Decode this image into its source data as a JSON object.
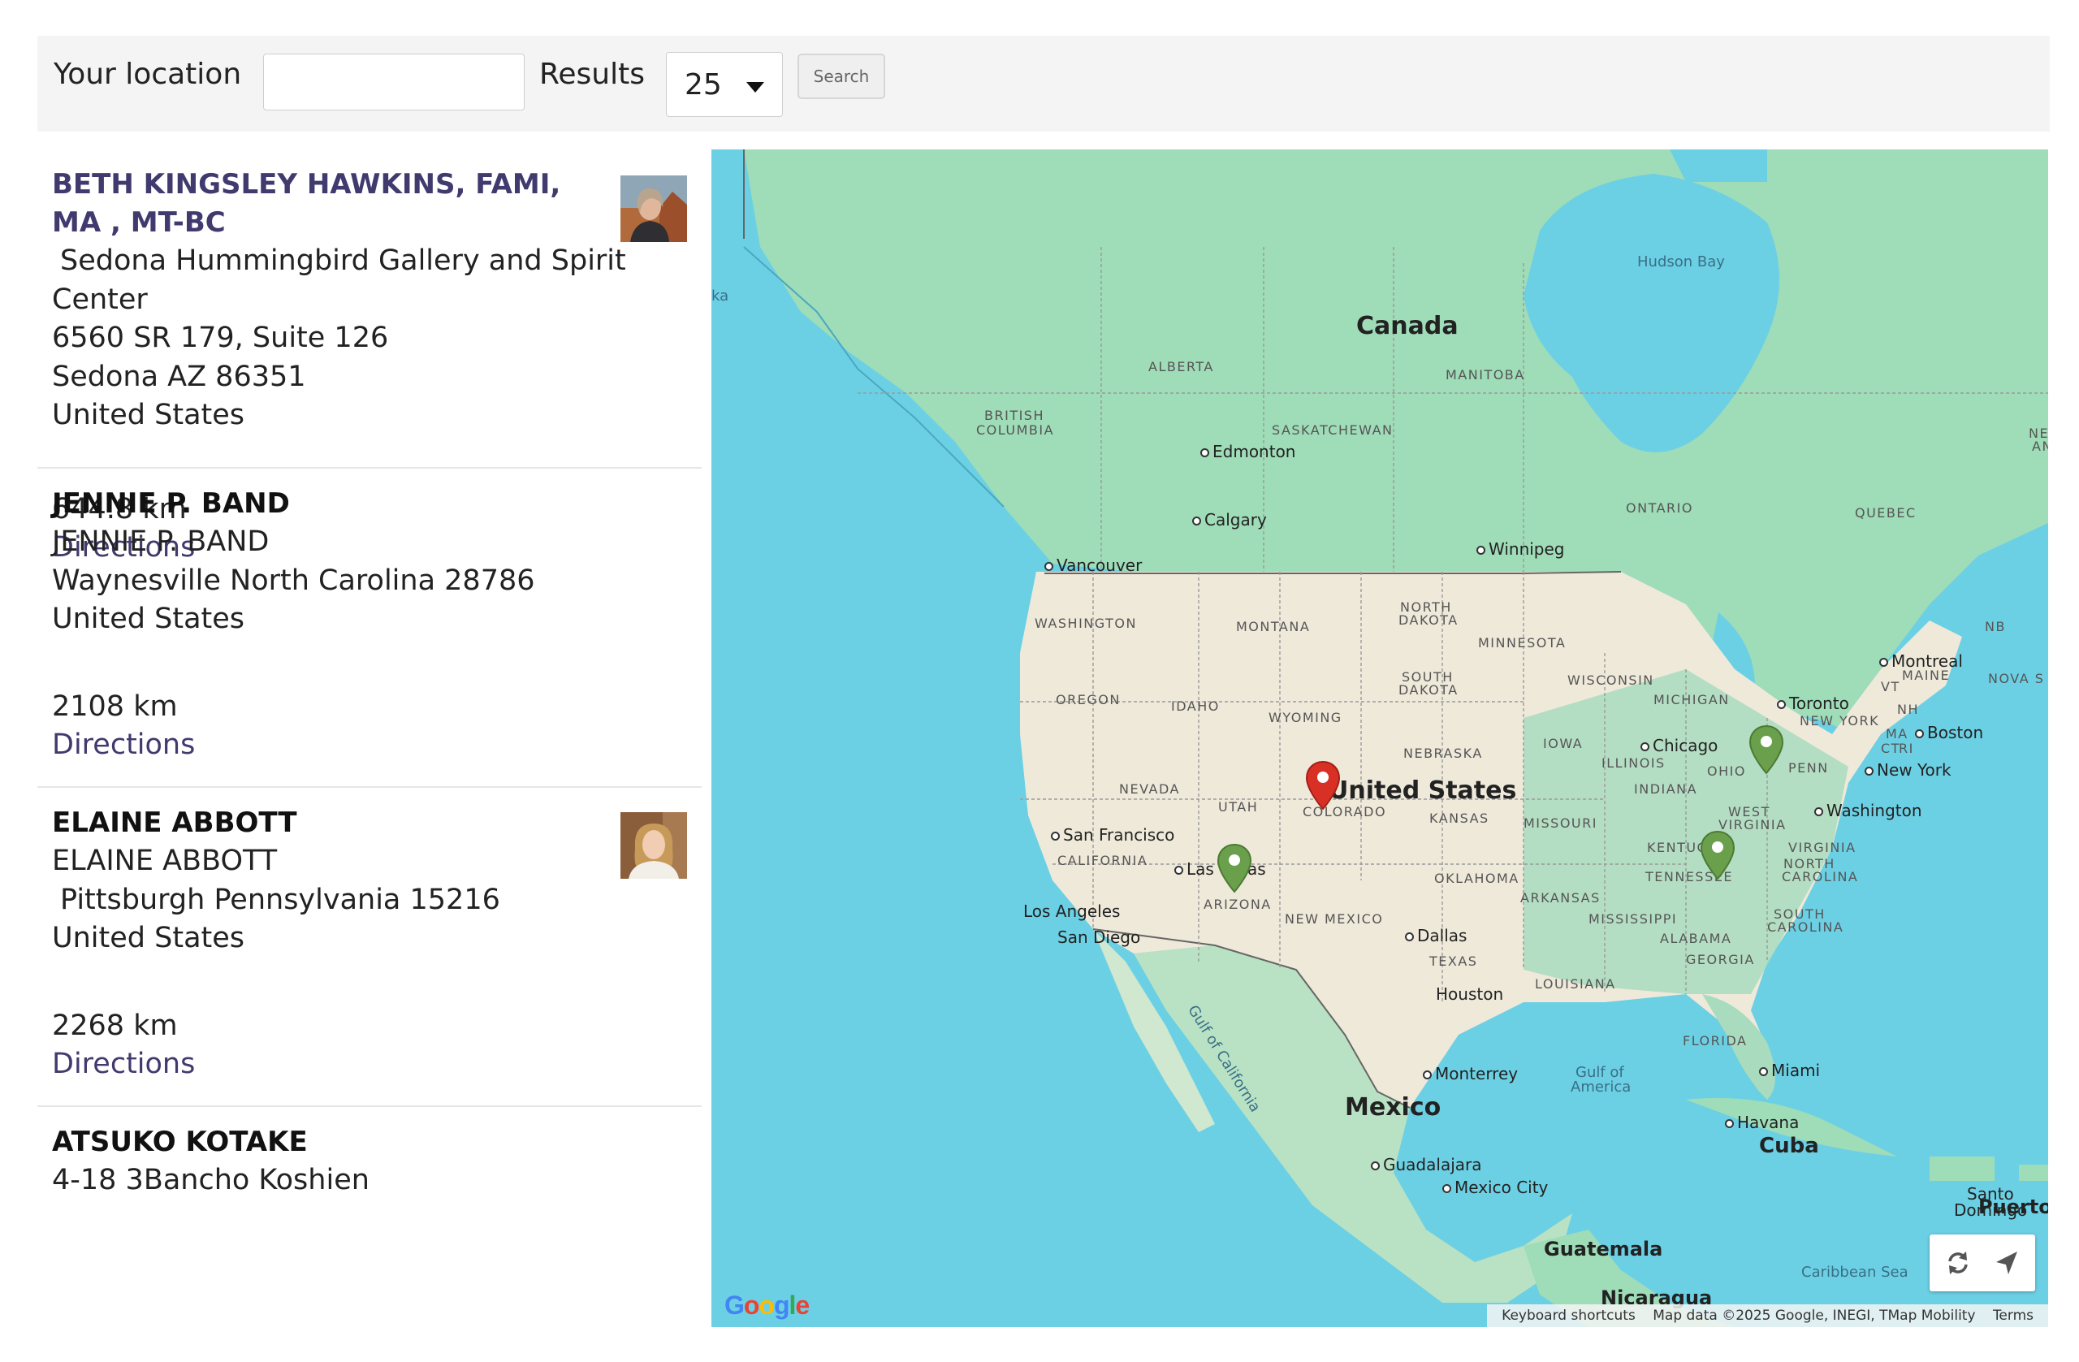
{
  "search": {
    "location_label": "Your location",
    "location_value": "",
    "results_label": "Results",
    "results_value": "25",
    "search_button": "Search"
  },
  "results": [
    {
      "name_line1": "BETH KINGSLEY HAWKINS, FAMI,",
      "name_line2": "MA , MT-BC",
      "address1": "Sedona Hummingbird Gallery and Spirit",
      "address2": "Center",
      "address3": "6560 SR 179, Suite 126",
      "address4": "Sedona AZ 86351",
      "address5": "United States",
      "distance": "644.8 km",
      "directions": "Directions"
    },
    {
      "name_line1": "JENNIE P. BAND",
      "address1": "JENNIE P. BAND",
      "address2": "Waynesville North Carolina 28786",
      "address3": "United States",
      "distance": "2108 km",
      "directions": "Directions"
    },
    {
      "name_line1": "ELAINE ABBOTT",
      "address1": "ELAINE ABBOTT",
      "address2": "Pittsburgh Pennsylvania 15216",
      "address3": "United States",
      "distance": "2268 km",
      "directions": "Directions"
    },
    {
      "name_line1": "ATSUKO KOTAKE",
      "address1": "4-18 3Bancho Koshien"
    }
  ],
  "map": {
    "countries": [
      "Canada",
      "United States",
      "Mexico",
      "Cuba",
      "Guatemala",
      "Nicaragua",
      "Puerto"
    ],
    "states": [
      "ALBERTA",
      "BRITISH",
      "COLUMBIA",
      "SASKATCHEWAN",
      "MANITOBA",
      "ONTARIO",
      "QUEBEC",
      "WASHINGTON",
      "MONTANA",
      "NORTH",
      "DAKOTA",
      "MINNESOTA",
      "OREGON",
      "IDAHO",
      "WYOMING",
      "SOUTH",
      "DAKOTA",
      "WISCONSIN",
      "MICHIGAN",
      "NEW YORK",
      "NEVADA",
      "UTAH",
      "COLORADO",
      "NEBRASKA",
      "IOWA",
      "ILLINOIS",
      "OHIO",
      "PENN",
      "CALIFORNIA",
      "KANSAS",
      "MISSOURI",
      "INDIANA",
      "WEST",
      "VIRGINIA",
      "KENTUC",
      "VIRGINIA",
      "ARIZONA",
      "NEW MEXICO",
      "OKLAHOMA",
      "TENNESSEE",
      "NORTH",
      "CAROLINA",
      "ARKANSAS",
      "MISSISSIPPI",
      "ALABAMA",
      "SOUTH",
      "CAROLINA",
      "GEORGIA",
      "TEXAS",
      "LOUISIANA",
      "FLORIDA",
      "MAINE",
      "VT",
      "NH",
      "MA",
      "CT",
      "RI",
      "NB",
      "NOVA S",
      "NEW",
      "AN"
    ],
    "cities": [
      "Edmonton",
      "Calgary",
      "Winnipeg",
      "Vancouver",
      "Montreal",
      "Toronto",
      "Boston",
      "New York",
      "Chicago",
      "Washington",
      "San Francisco",
      "Las",
      "as",
      "Los Angeles",
      "San Diego",
      "Dallas",
      "Houston",
      "Monterrey",
      "Miami",
      "Havana",
      "Guadalajara",
      "Mexico City",
      "Santo",
      "Domingo"
    ],
    "waters": [
      "Hudson Bay",
      "Gulf of",
      "America",
      "Gulf of California",
      "Caribbean Sea",
      "ka"
    ],
    "markers": [
      {
        "name": "red-user-location-marker",
        "color": "#d93025"
      },
      {
        "name": "green-result-marker-sedona",
        "color": "#6a9f4b"
      },
      {
        "name": "green-result-marker-waynesville",
        "color": "#6a9f4b"
      },
      {
        "name": "green-result-marker-pittsburgh",
        "color": "#6a9f4b"
      }
    ],
    "attribution": {
      "shortcuts": "Keyboard shortcuts",
      "data": "Map data ©2025 Google, INEGI, TMap Mobility",
      "terms": "Terms"
    },
    "logo": "Google"
  },
  "colors": {
    "accent_link": "#413a6e",
    "ocean": "#6cd0e4",
    "land_green": "#9fdcb8",
    "land_tan": "#efe9da"
  }
}
